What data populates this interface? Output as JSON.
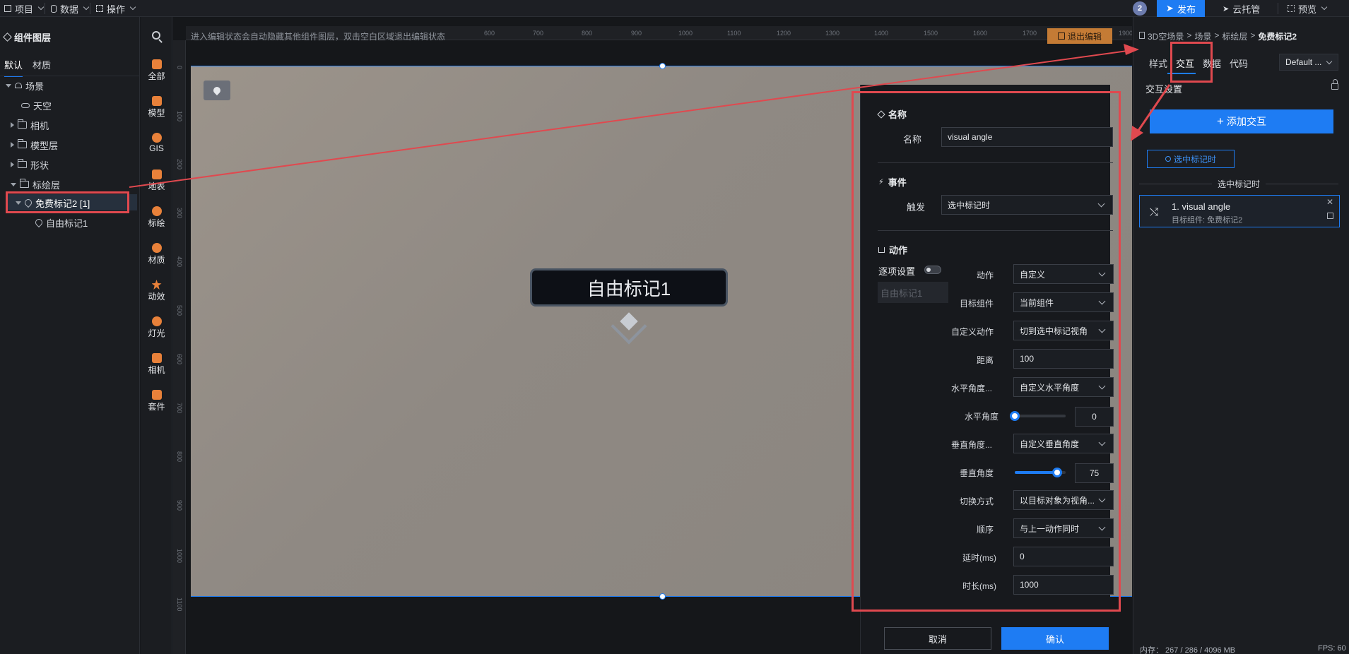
{
  "topbar": {
    "menus": [
      {
        "label": "项目"
      },
      {
        "label": "数据"
      },
      {
        "label": "操作"
      }
    ],
    "notification_count": "2",
    "publish_label": "发布",
    "cloud_label": "云托管",
    "preview_label": "预览"
  },
  "layer_panel": {
    "title": "组件图层",
    "tabs": [
      "默认",
      "材质"
    ],
    "tree": [
      {
        "label": "场景"
      },
      {
        "label": "天空"
      },
      {
        "label": "相机"
      },
      {
        "label": "模型层"
      },
      {
        "label": "形状"
      },
      {
        "label": "标绘层"
      },
      {
        "label": "免费标记2 [1]"
      },
      {
        "label": "自由标记1"
      }
    ]
  },
  "icon_bar": {
    "items": [
      "全部",
      "模型",
      "GIS",
      "地表",
      "标绘",
      "材质",
      "动效",
      "灯光",
      "相机",
      "套件"
    ]
  },
  "canvas": {
    "hint": "进入编辑状态会自动隐藏其他组件图层，双击空白区域退出编辑状态",
    "exit_edit_label": "退出编辑",
    "ruler_top": [
      "600",
      "700",
      "800",
      "900",
      "1000",
      "1100",
      "1200",
      "1300",
      "1400",
      "1500",
      "1600",
      "1700",
      "1800",
      "1900"
    ],
    "ruler_left": [
      "0",
      "100",
      "200",
      "300",
      "400",
      "500",
      "600",
      "700",
      "800",
      "900",
      "1000",
      "1100"
    ],
    "marker_label": "自由标记1"
  },
  "dialog": {
    "name_section": "名称",
    "name_label": "名称",
    "name_value": "visual angle",
    "event_section": "事件",
    "trigger_label": "触发",
    "trigger_value": "选中标记时",
    "action_section": "动作",
    "per_item_label": "逐项设置",
    "item_chip": "自由标记1",
    "rows": {
      "action": {
        "label": "动作",
        "value": "自定义"
      },
      "target": {
        "label": "目标组件",
        "value": "当前组件"
      },
      "custom_action": {
        "label": "自定义动作",
        "value": "切到选中标记视角"
      },
      "distance": {
        "label": "距离",
        "value": "100"
      },
      "h_angle_mode": {
        "label": "水平角度...",
        "value": "自定义水平角度"
      },
      "h_angle": {
        "label": "水平角度",
        "value": "0"
      },
      "v_angle_mode": {
        "label": "垂直角度...",
        "value": "自定义垂直角度"
      },
      "v_angle": {
        "label": "垂直角度",
        "value": "75"
      },
      "switch_mode": {
        "label": "切换方式",
        "value": "以目标对象为视角..."
      },
      "order": {
        "label": "顺序",
        "value": "与上一动作同时"
      },
      "delay": {
        "label": "延时(ms)",
        "value": "0"
      },
      "duration": {
        "label": "时长(ms)",
        "value": "1000"
      }
    },
    "h_angle_fraction": 0.0,
    "v_angle_fraction": 0.83,
    "cancel_label": "取消",
    "confirm_label": "确认"
  },
  "right_panel": {
    "breadcrumb": [
      "3D空场景",
      "场景",
      "标绘层",
      "免费标记2"
    ],
    "tabs": [
      "样式",
      "交互",
      "数据",
      "代码"
    ],
    "active_tab": "交互",
    "preset": "Default ...",
    "section_title": "交互设置",
    "add_label": "添加交互",
    "trigger_tag": "选中标记时",
    "group_label": "选中标记时",
    "card_title": "1. visual angle",
    "card_sub": "目标组件: 免费标记2",
    "memory": "内存： 267 / 286 / 4096 MB",
    "fps": "FPS:  60"
  },
  "colors": {
    "accent": "#1e7cf3",
    "annotation": "#e0494f",
    "exit_edit": "#c47b35",
    "icon_orange": "#e8813a"
  }
}
